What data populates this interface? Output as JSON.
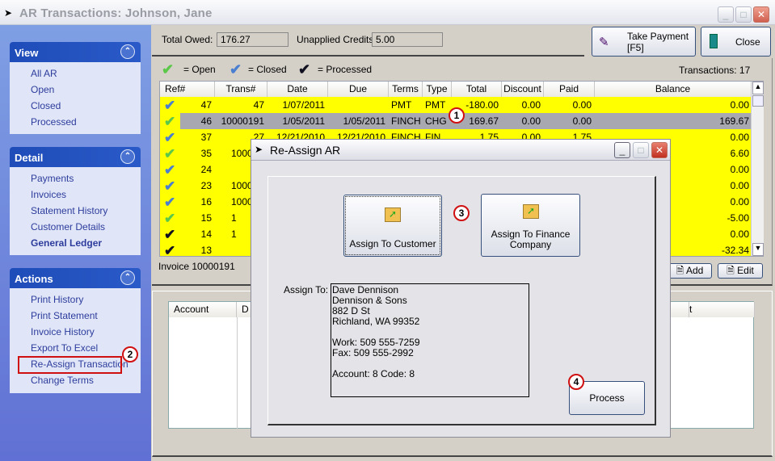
{
  "window": {
    "title": "AR Transactions: Johnson, Jane"
  },
  "sidebar": {
    "view": {
      "title": "View",
      "items": [
        "All AR",
        "Open",
        "Closed",
        "Processed"
      ]
    },
    "detail": {
      "title": "Detail",
      "items": [
        "Payments",
        "Invoices",
        "Statement History",
        "Customer Details",
        "General Ledger"
      ]
    },
    "actions": {
      "title": "Actions",
      "items": [
        "Print History",
        "Print Statement",
        "Invoice History",
        "Export To Excel",
        "Re-Assign Transaction",
        "Change Terms"
      ]
    }
  },
  "summary": {
    "total_owed_label": "Total Owed:",
    "total_owed": "176.27",
    "unapplied_label": "Unapplied Credits:",
    "unapplied": "5.00"
  },
  "toolbar": {
    "take_payment": "Take Payment",
    "take_payment_key": "[F5]",
    "close": "Close"
  },
  "legend": {
    "open": "= Open",
    "closed": "= Closed",
    "processed": "= Processed",
    "colors": {
      "open": "#5cc84a",
      "closed": "#4a7ed0",
      "processed": "#101020"
    }
  },
  "transactions_count": "Transactions:  17",
  "grid": {
    "columns": [
      "Ref#",
      "Trans#",
      "Date",
      "Due",
      "Terms",
      "Type",
      "Total",
      "Discount",
      "Paid",
      "Balance"
    ],
    "rows": [
      {
        "status": "closed",
        "cells": [
          "47",
          "47",
          "1/07/2011",
          "",
          "PMT",
          "PMT",
          "-180.00",
          "0.00",
          "0.00",
          "0.00"
        ]
      },
      {
        "status": "open",
        "selected": true,
        "cells": [
          "46",
          "10000191",
          "1/05/2011",
          "1/05/2011",
          "FINCH",
          "CHG",
          "169.67",
          "0.00",
          "0.00",
          "169.67"
        ]
      },
      {
        "status": "closed",
        "cells": [
          "37",
          "27",
          "12/21/2010",
          "12/21/2010",
          "FINCH",
          "FIN",
          "1.75",
          "0.00",
          "1.75",
          "0.00"
        ]
      },
      {
        "status": "open",
        "cells": [
          "35",
          "10000",
          "",
          "",
          "",
          "",
          "",
          "",
          "",
          "6.60"
        ]
      },
      {
        "status": "closed",
        "cells": [
          "24",
          "",
          "",
          "",
          "",
          "",
          "",
          "",
          "",
          "0.00"
        ]
      },
      {
        "status": "closed",
        "cells": [
          "23",
          "10000",
          "",
          "",
          "",
          "",
          "",
          "",
          "",
          "0.00"
        ]
      },
      {
        "status": "closed",
        "cells": [
          "16",
          "10000",
          "",
          "",
          "",
          "",
          "",
          "",
          "",
          "0.00"
        ]
      },
      {
        "status": "open",
        "cells": [
          "15",
          "1",
          "",
          "",
          "",
          "",
          "",
          "",
          "",
          "-5.00"
        ]
      },
      {
        "status": "processed",
        "cells": [
          "14",
          "1",
          "",
          "",
          "",
          "",
          "",
          "",
          "",
          "0.00"
        ]
      },
      {
        "status": "processed",
        "cells": [
          "13",
          "",
          "",
          "",
          "",
          "",
          "",
          "",
          "",
          "-32.34"
        ]
      }
    ]
  },
  "invoice_label": "Invoice 10000191",
  "grid_buttons": {
    "add": "Add",
    "edit": "Edit"
  },
  "gl_table": {
    "columns": [
      "Account",
      "D",
      "t"
    ]
  },
  "dialog": {
    "title": "Re-Assign AR",
    "assign_customer": "Assign To Customer",
    "assign_finance": "Assign To Finance Company",
    "assign_to_label": "Assign To:",
    "assign_to_lines": [
      "Dave Dennison",
      "Dennison & Sons",
      "882 D St",
      "Richland, WA  99352",
      "",
      "Work: 509 555-7259",
      "Fax: 509 555-2992",
      "",
      "Account: 8 Code: 8"
    ],
    "process": "Process"
  },
  "callouts": [
    "1",
    "2",
    "3",
    "4"
  ]
}
